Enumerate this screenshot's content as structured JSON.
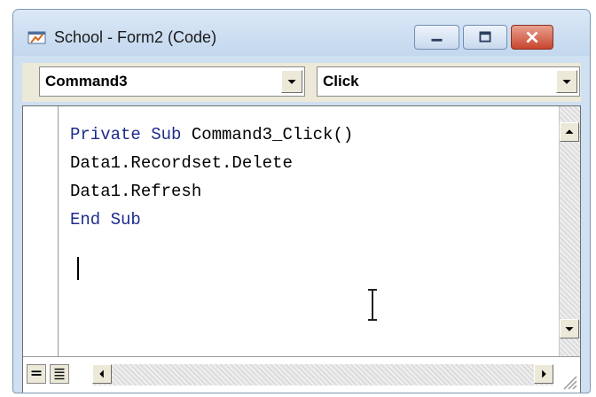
{
  "window": {
    "title": "School - Form2 (Code)",
    "icon": "vb-code-window-icon"
  },
  "title_buttons": {
    "minimize": "minimize-icon",
    "maximize": "maximize-icon",
    "close": "close-icon"
  },
  "object_combo": {
    "selected": "Command3"
  },
  "procedure_combo": {
    "selected": "Click"
  },
  "code": {
    "lines": [
      [
        {
          "t": "Private Sub ",
          "kw": true
        },
        {
          "t": "Command3_Click()",
          "kw": false
        }
      ],
      [
        {
          "t": "Data1.Recordset.Delete",
          "kw": false
        }
      ],
      [
        {
          "t": "Data1.Refresh",
          "kw": false
        }
      ],
      [
        {
          "t": "End Sub",
          "kw": true
        }
      ]
    ]
  },
  "colors": {
    "keyword": "#1e2c8c",
    "text": "#000000",
    "close_button": "#c8452e",
    "frame": "#cfe0f3"
  }
}
